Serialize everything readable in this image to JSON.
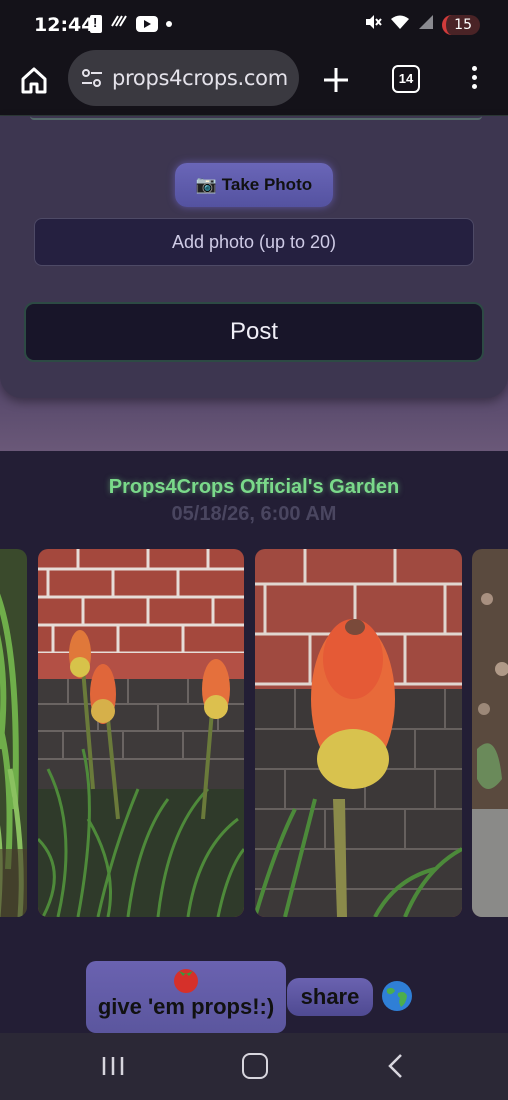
{
  "status_bar": {
    "time": "12:44",
    "battery_badge": "15",
    "icons": [
      "battery-alert-icon",
      "signal-bars-icon",
      "youtube-icon",
      "notification-dot-icon",
      "mute-icon",
      "wifi-icon",
      "cell-signal-icon"
    ]
  },
  "browser": {
    "url": "props4crops.com",
    "tab_count": "14",
    "icons": [
      "home-icon",
      "tune-icon",
      "plus-icon",
      "tabs-icon",
      "more-vert-icon"
    ]
  },
  "upload": {
    "take_photo_label": "📷 Take Photo",
    "add_photo_label": "Add photo (up to 20)",
    "post_label": "Post"
  },
  "feed": {
    "garden_title": "Props4Crops Official's Garden",
    "date": "05/18/26, 6:00 AM",
    "photos": [
      {
        "subject": "green foliage (partial)"
      },
      {
        "subject": "red hot poker flowers against brick wall"
      },
      {
        "subject": "single red hot poker flower close-up"
      },
      {
        "subject": "garden bed (partial)"
      }
    ],
    "props_emoji": "🍅",
    "props_label": "give 'em props!:)",
    "share_label": "share",
    "globe_emoji": "🌍"
  },
  "colors": {
    "accent_green": "#7ad98a",
    "button_purple": "#6a62b0",
    "card_bg": "#3d3650",
    "feed_bg": "#231e35"
  }
}
